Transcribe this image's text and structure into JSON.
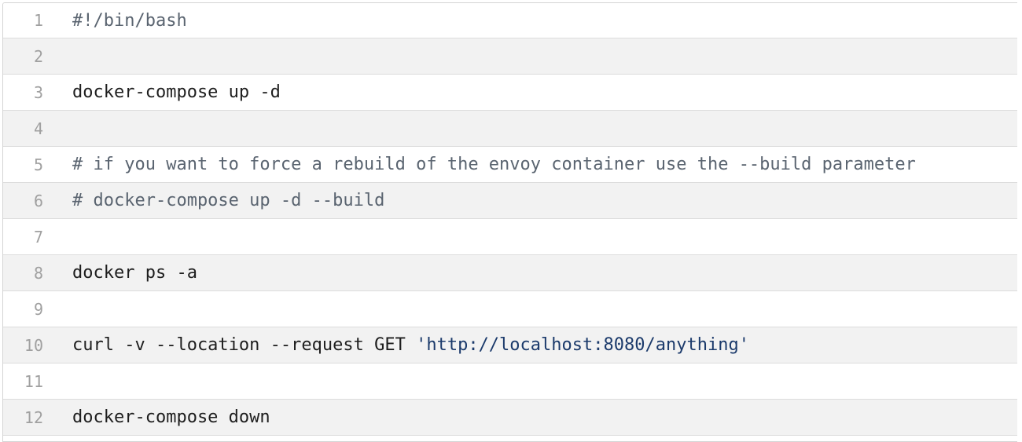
{
  "code_viewer": {
    "lines": [
      {
        "number": "1",
        "text": "#!/bin/bash",
        "kind": "comment"
      },
      {
        "number": "2",
        "text": "",
        "kind": "blank"
      },
      {
        "number": "3",
        "text": "docker-compose up -d",
        "kind": "code"
      },
      {
        "number": "4",
        "text": "",
        "kind": "blank"
      },
      {
        "number": "5",
        "text": "# if you want to force a rebuild of the envoy container use the --build parameter",
        "kind": "comment"
      },
      {
        "number": "6",
        "text": "# docker-compose up -d --build",
        "kind": "comment"
      },
      {
        "number": "7",
        "text": "",
        "kind": "blank"
      },
      {
        "number": "8",
        "text": "docker ps -a",
        "kind": "code"
      },
      {
        "number": "9",
        "text": "",
        "kind": "blank"
      },
      {
        "number": "10",
        "text": "curl -v --location --request GET ",
        "string": "'http://localhost:8080/anything'",
        "kind": "code"
      },
      {
        "number": "11",
        "text": "",
        "kind": "blank"
      },
      {
        "number": "12",
        "text": "docker-compose down",
        "kind": "code"
      }
    ],
    "colors": {
      "text": "#1e1e1e",
      "comment": "#5a6470",
      "string": "#1b3a6b",
      "line_number": "#a0a0a0",
      "stripe": "#f2f2f2"
    }
  }
}
